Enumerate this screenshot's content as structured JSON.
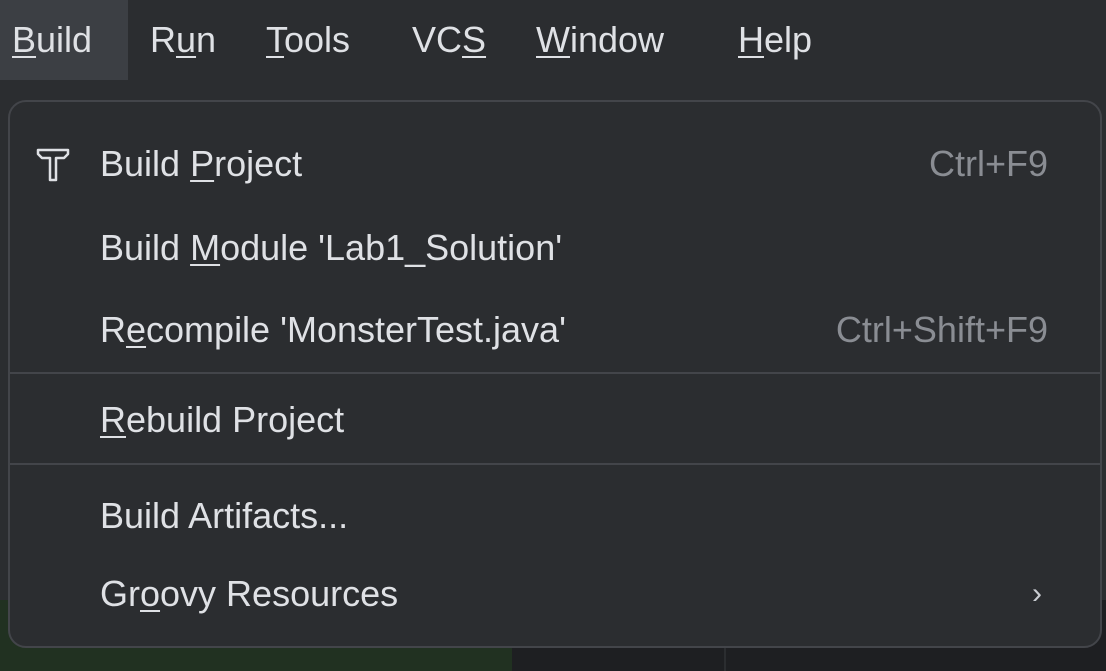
{
  "menubar": {
    "items": [
      {
        "pre": "",
        "mn": "B",
        "post": "uild"
      },
      {
        "pre": "R",
        "mn": "u",
        "post": "n"
      },
      {
        "pre": "",
        "mn": "T",
        "post": "ools"
      },
      {
        "pre": "VC",
        "mn": "S",
        "post": ""
      },
      {
        "pre": "",
        "mn": "W",
        "post": "indow"
      },
      {
        "pre": "",
        "mn": "H",
        "post": "elp"
      }
    ]
  },
  "build_menu": {
    "items": [
      {
        "pre": "Build ",
        "mn": "P",
        "post": "roject",
        "shortcut": "Ctrl+F9",
        "icon": "hammer-icon"
      },
      {
        "pre": "Build ",
        "mn": "M",
        "post": "odule 'Lab1_Solution'",
        "shortcut": ""
      },
      {
        "pre": "R",
        "mn": "e",
        "post": "compile 'MonsterTest.java'",
        "shortcut": "Ctrl+Shift+F9"
      },
      {
        "pre": "",
        "mn": "R",
        "post": "ebuild Project",
        "shortcut": ""
      },
      {
        "pre": "Build Artifacts...",
        "mn": "",
        "post": "",
        "shortcut": ""
      },
      {
        "pre": "Gr",
        "mn": "o",
        "post": "ovy Resources",
        "shortcut": "",
        "submenu_icon": "chevron-right-icon"
      }
    ],
    "chevron": "›"
  },
  "colors": {
    "background": "#2b2d30",
    "text": "#dfe1e5",
    "shortcut": "#8a8d93",
    "border": "#43454a",
    "active_menu": "#3c3f44"
  }
}
